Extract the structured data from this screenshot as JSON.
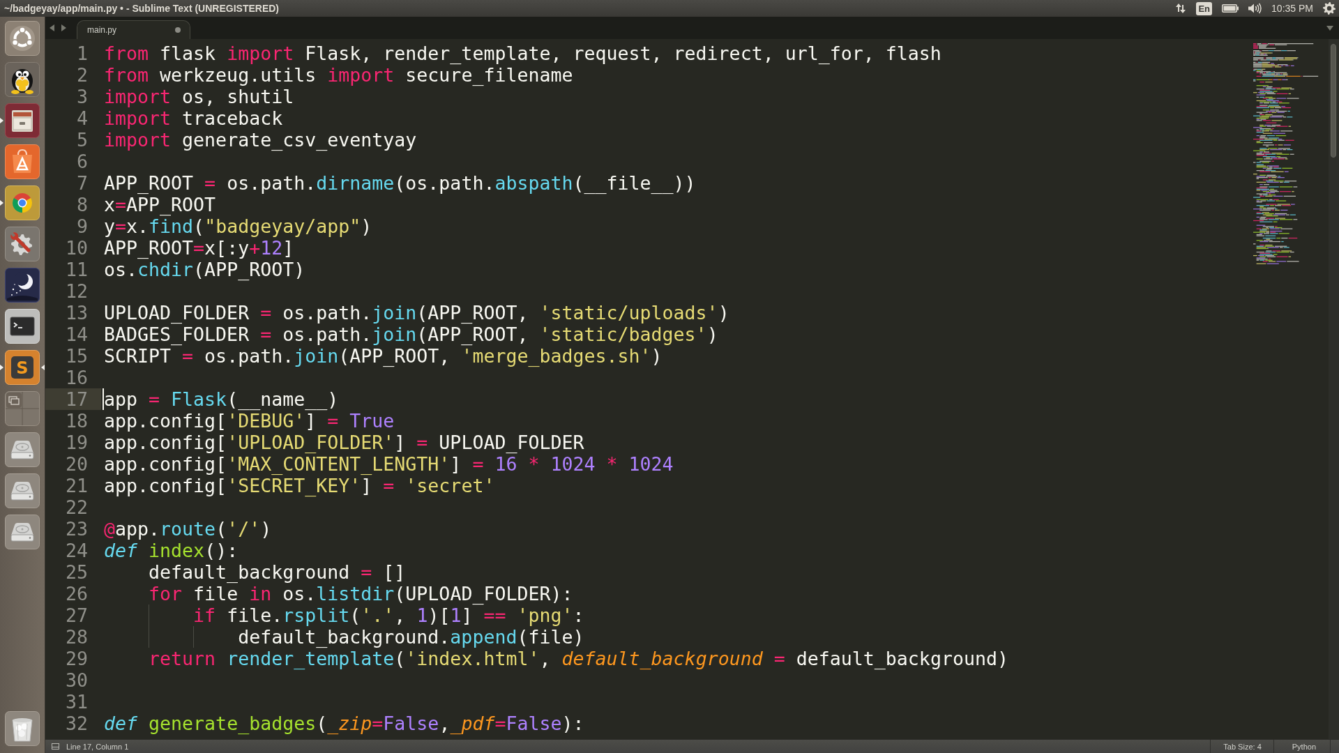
{
  "window": {
    "title": "~/badgeyay/app/main.py • - Sublime Text (UNREGISTERED)"
  },
  "panel": {
    "indicators": [
      {
        "kind": "network"
      },
      {
        "kind": "keyboard",
        "label": "En"
      },
      {
        "kind": "battery"
      },
      {
        "kind": "sound"
      },
      {
        "kind": "clock",
        "label": "10:35 PM"
      },
      {
        "kind": "session"
      }
    ]
  },
  "launcher": {
    "items": [
      {
        "kind": "dash",
        "running": false,
        "focused": false
      },
      {
        "kind": "penguin",
        "running": false,
        "focused": false
      },
      {
        "kind": "files",
        "running": true,
        "focused": false
      },
      {
        "kind": "store",
        "running": false,
        "focused": false
      },
      {
        "kind": "browser",
        "running": true,
        "focused": false
      },
      {
        "kind": "settings",
        "running": false,
        "focused": false
      },
      {
        "kind": "sky",
        "running": false,
        "focused": false
      },
      {
        "kind": "terminal",
        "running": false,
        "focused": false
      },
      {
        "kind": "editor",
        "label": "S",
        "running": true,
        "focused": true
      },
      {
        "kind": "workspaces",
        "running": false,
        "focused": false
      },
      {
        "kind": "drive",
        "running": false,
        "focused": false
      },
      {
        "kind": "drive",
        "running": false,
        "focused": false
      },
      {
        "kind": "drive",
        "running": false,
        "focused": false
      },
      {
        "kind": "trash",
        "running": false,
        "focused": false
      }
    ]
  },
  "tabs": [
    {
      "label": "main.py",
      "selected": true,
      "modified": true
    }
  ],
  "editor": {
    "lines": [
      {
        "number": "1",
        "current": false,
        "tokens": [
          {
            "kind": "keyword",
            "text": "from"
          },
          {
            "kind": "plain",
            "text": " flask "
          },
          {
            "kind": "keyword",
            "text": "import"
          },
          {
            "kind": "plain",
            "text": " Flask, render_template, request, redirect, url_for, flash"
          }
        ]
      },
      {
        "number": "2",
        "current": false,
        "tokens": [
          {
            "kind": "keyword",
            "text": "from"
          },
          {
            "kind": "plain",
            "text": " werkzeug.utils "
          },
          {
            "kind": "keyword",
            "text": "import"
          },
          {
            "kind": "plain",
            "text": " secure_filename"
          }
        ]
      },
      {
        "number": "3",
        "current": false,
        "tokens": [
          {
            "kind": "keyword",
            "text": "import"
          },
          {
            "kind": "plain",
            "text": " os, shutil"
          }
        ]
      },
      {
        "number": "4",
        "current": false,
        "tokens": [
          {
            "kind": "keyword",
            "text": "import"
          },
          {
            "kind": "plain",
            "text": " traceback"
          }
        ]
      },
      {
        "number": "5",
        "current": false,
        "tokens": [
          {
            "kind": "keyword",
            "text": "import"
          },
          {
            "kind": "plain",
            "text": " generate_csv_eventyay"
          }
        ]
      },
      {
        "number": "6",
        "current": false
      },
      {
        "number": "7",
        "current": false,
        "tokens": [
          {
            "kind": "plain",
            "text": "APP_ROOT "
          },
          {
            "kind": "keyword",
            "text": "="
          },
          {
            "kind": "plain",
            "text": " os.path."
          },
          {
            "kind": "function",
            "text": "dirname"
          },
          {
            "kind": "plain",
            "text": "(os.path."
          },
          {
            "kind": "function",
            "text": "abspath"
          },
          {
            "kind": "plain",
            "text": "(__file__))"
          }
        ]
      },
      {
        "number": "8",
        "current": false,
        "tokens": [
          {
            "kind": "plain",
            "text": "x"
          },
          {
            "kind": "keyword",
            "text": "="
          },
          {
            "kind": "plain",
            "text": "APP_ROOT"
          }
        ]
      },
      {
        "number": "9",
        "current": false,
        "tokens": [
          {
            "kind": "plain",
            "text": "y"
          },
          {
            "kind": "keyword",
            "text": "="
          },
          {
            "kind": "plain",
            "text": "x."
          },
          {
            "kind": "function",
            "text": "find"
          },
          {
            "kind": "plain",
            "text": "("
          },
          {
            "kind": "string",
            "text": "\"badgeyay/app\""
          },
          {
            "kind": "plain",
            "text": ")"
          }
        ]
      },
      {
        "number": "10",
        "current": false,
        "tokens": [
          {
            "kind": "plain",
            "text": "APP_ROOT"
          },
          {
            "kind": "keyword",
            "text": "="
          },
          {
            "kind": "plain",
            "text": "x[:y"
          },
          {
            "kind": "keyword",
            "text": "+"
          },
          {
            "kind": "number",
            "text": "12"
          },
          {
            "kind": "plain",
            "text": "]"
          }
        ]
      },
      {
        "number": "11",
        "current": false,
        "tokens": [
          {
            "kind": "plain",
            "text": "os."
          },
          {
            "kind": "function",
            "text": "chdir"
          },
          {
            "kind": "plain",
            "text": "(APP_ROOT)"
          }
        ]
      },
      {
        "number": "12",
        "current": false
      },
      {
        "number": "13",
        "current": false,
        "tokens": [
          {
            "kind": "plain",
            "text": "UPLOAD_FOLDER "
          },
          {
            "kind": "keyword",
            "text": "="
          },
          {
            "kind": "plain",
            "text": " os.path."
          },
          {
            "kind": "function",
            "text": "join"
          },
          {
            "kind": "plain",
            "text": "(APP_ROOT, "
          },
          {
            "kind": "string",
            "text": "'static/uploads'"
          },
          {
            "kind": "plain",
            "text": ")"
          }
        ]
      },
      {
        "number": "14",
        "current": false,
        "tokens": [
          {
            "kind": "plain",
            "text": "BADGES_FOLDER "
          },
          {
            "kind": "keyword",
            "text": "="
          },
          {
            "kind": "plain",
            "text": " os.path."
          },
          {
            "kind": "function",
            "text": "join"
          },
          {
            "kind": "plain",
            "text": "(APP_ROOT, "
          },
          {
            "kind": "string",
            "text": "'static/badges'"
          },
          {
            "kind": "plain",
            "text": ")"
          }
        ]
      },
      {
        "number": "15",
        "current": false,
        "tokens": [
          {
            "kind": "plain",
            "text": "SCRIPT "
          },
          {
            "kind": "keyword",
            "text": "="
          },
          {
            "kind": "plain",
            "text": " os.path."
          },
          {
            "kind": "function",
            "text": "join"
          },
          {
            "kind": "plain",
            "text": "(APP_ROOT, "
          },
          {
            "kind": "string",
            "text": "'merge_badges.sh'"
          },
          {
            "kind": "plain",
            "text": ")"
          }
        ]
      },
      {
        "number": "16",
        "current": false
      },
      {
        "number": "17",
        "current": true,
        "tokens": [
          {
            "kind": "plain",
            "text": "app "
          },
          {
            "kind": "keyword",
            "text": "="
          },
          {
            "kind": "function",
            "text": " Flask"
          },
          {
            "kind": "plain",
            "text": "(__name__)"
          }
        ]
      },
      {
        "number": "18",
        "current": false,
        "tokens": [
          {
            "kind": "plain",
            "text": "app.config["
          },
          {
            "kind": "string",
            "text": "'DEBUG'"
          },
          {
            "kind": "plain",
            "text": "] "
          },
          {
            "kind": "keyword",
            "text": "="
          },
          {
            "kind": "number",
            "text": " True"
          }
        ]
      },
      {
        "number": "19",
        "current": false,
        "tokens": [
          {
            "kind": "plain",
            "text": "app.config["
          },
          {
            "kind": "string",
            "text": "'UPLOAD_FOLDER'"
          },
          {
            "kind": "plain",
            "text": "] "
          },
          {
            "kind": "keyword",
            "text": "="
          },
          {
            "kind": "plain",
            "text": " UPLOAD_FOLDER"
          }
        ]
      },
      {
        "number": "20",
        "current": false,
        "tokens": [
          {
            "kind": "plain",
            "text": "app.config["
          },
          {
            "kind": "string",
            "text": "'MAX_CONTENT_LENGTH'"
          },
          {
            "kind": "plain",
            "text": "] "
          },
          {
            "kind": "keyword",
            "text": "="
          },
          {
            "kind": "number",
            "text": " 16 "
          },
          {
            "kind": "keyword",
            "text": "*"
          },
          {
            "kind": "number",
            "text": " 1024 "
          },
          {
            "kind": "keyword",
            "text": "*"
          },
          {
            "kind": "number",
            "text": " 1024"
          }
        ]
      },
      {
        "number": "21",
        "current": false,
        "tokens": [
          {
            "kind": "plain",
            "text": "app.config["
          },
          {
            "kind": "string",
            "text": "'SECRET_KEY'"
          },
          {
            "kind": "plain",
            "text": "] "
          },
          {
            "kind": "keyword",
            "text": "="
          },
          {
            "kind": "string",
            "text": " 'secret'"
          }
        ]
      },
      {
        "number": "22",
        "current": false
      },
      {
        "number": "23",
        "current": false,
        "tokens": [
          {
            "kind": "keyword",
            "text": "@"
          },
          {
            "kind": "plain",
            "text": "app."
          },
          {
            "kind": "function",
            "text": "route"
          },
          {
            "kind": "plain",
            "text": "("
          },
          {
            "kind": "string",
            "text": "'/'"
          },
          {
            "kind": "plain",
            "text": ")"
          }
        ]
      },
      {
        "number": "24",
        "current": false,
        "tokens": [
          {
            "kind": "storage",
            "text": "def"
          },
          {
            "kind": "name",
            "text": " index"
          },
          {
            "kind": "plain",
            "text": "():"
          }
        ]
      },
      {
        "number": "25",
        "current": false,
        "tokens": [
          {
            "kind": "plain",
            "text": "    default_background "
          },
          {
            "kind": "keyword",
            "text": "="
          },
          {
            "kind": "plain",
            "text": " []"
          }
        ]
      },
      {
        "number": "26",
        "current": false,
        "tokens": [
          {
            "kind": "keyword",
            "text": "    for"
          },
          {
            "kind": "plain",
            "text": " file "
          },
          {
            "kind": "keyword",
            "text": "in"
          },
          {
            "kind": "plain",
            "text": " os."
          },
          {
            "kind": "function",
            "text": "listdir"
          },
          {
            "kind": "plain",
            "text": "(UPLOAD_FOLDER):"
          }
        ]
      },
      {
        "number": "27",
        "current": false,
        "tokens": [
          {
            "kind": "keyword",
            "text": "        if"
          },
          {
            "kind": "plain",
            "text": " file."
          },
          {
            "kind": "function",
            "text": "rsplit"
          },
          {
            "kind": "plain",
            "text": "("
          },
          {
            "kind": "string",
            "text": "'.'"
          },
          {
            "kind": "plain",
            "text": ", "
          },
          {
            "kind": "number",
            "text": "1"
          },
          {
            "kind": "plain",
            "text": ")["
          },
          {
            "kind": "number",
            "text": "1"
          },
          {
            "kind": "plain",
            "text": "] "
          },
          {
            "kind": "keyword",
            "text": "=="
          },
          {
            "kind": "string",
            "text": " 'png'"
          },
          {
            "kind": "plain",
            "text": ":"
          }
        ]
      },
      {
        "number": "28",
        "current": false,
        "tokens": [
          {
            "kind": "plain",
            "text": "            default_background."
          },
          {
            "kind": "function",
            "text": "append"
          },
          {
            "kind": "plain",
            "text": "(file)"
          }
        ]
      },
      {
        "number": "29",
        "current": false,
        "tokens": [
          {
            "kind": "keyword",
            "text": "    return"
          },
          {
            "kind": "function",
            "text": " render_template"
          },
          {
            "kind": "plain",
            "text": "("
          },
          {
            "kind": "string",
            "text": "'index.html'"
          },
          {
            "kind": "plain",
            "text": ", "
          },
          {
            "kind": "parameter",
            "text": "default_background"
          },
          {
            "kind": "keyword",
            "text": " = "
          },
          {
            "kind": "plain",
            "text": "default_background)"
          }
        ]
      },
      {
        "number": "30",
        "current": false
      },
      {
        "number": "31",
        "current": false
      },
      {
        "number": "32",
        "current": false,
        "tokens": [
          {
            "kind": "storage",
            "text": "def"
          },
          {
            "kind": "name",
            "text": " generate_badges"
          },
          {
            "kind": "plain",
            "text": "("
          },
          {
            "kind": "parameter",
            "text": "_zip"
          },
          {
            "kind": "keyword",
            "text": "="
          },
          {
            "kind": "number",
            "text": "False"
          },
          {
            "kind": "plain",
            "text": ","
          },
          {
            "kind": "parameter",
            "text": "_pdf"
          },
          {
            "kind": "keyword",
            "text": "="
          },
          {
            "kind": "number",
            "text": "False"
          },
          {
            "kind": "plain",
            "text": "):"
          }
        ]
      }
    ]
  },
  "status_bar": {
    "position": "Line 17, Column 1",
    "tab_size": "Tab Size: 4",
    "syntax": "Python"
  }
}
